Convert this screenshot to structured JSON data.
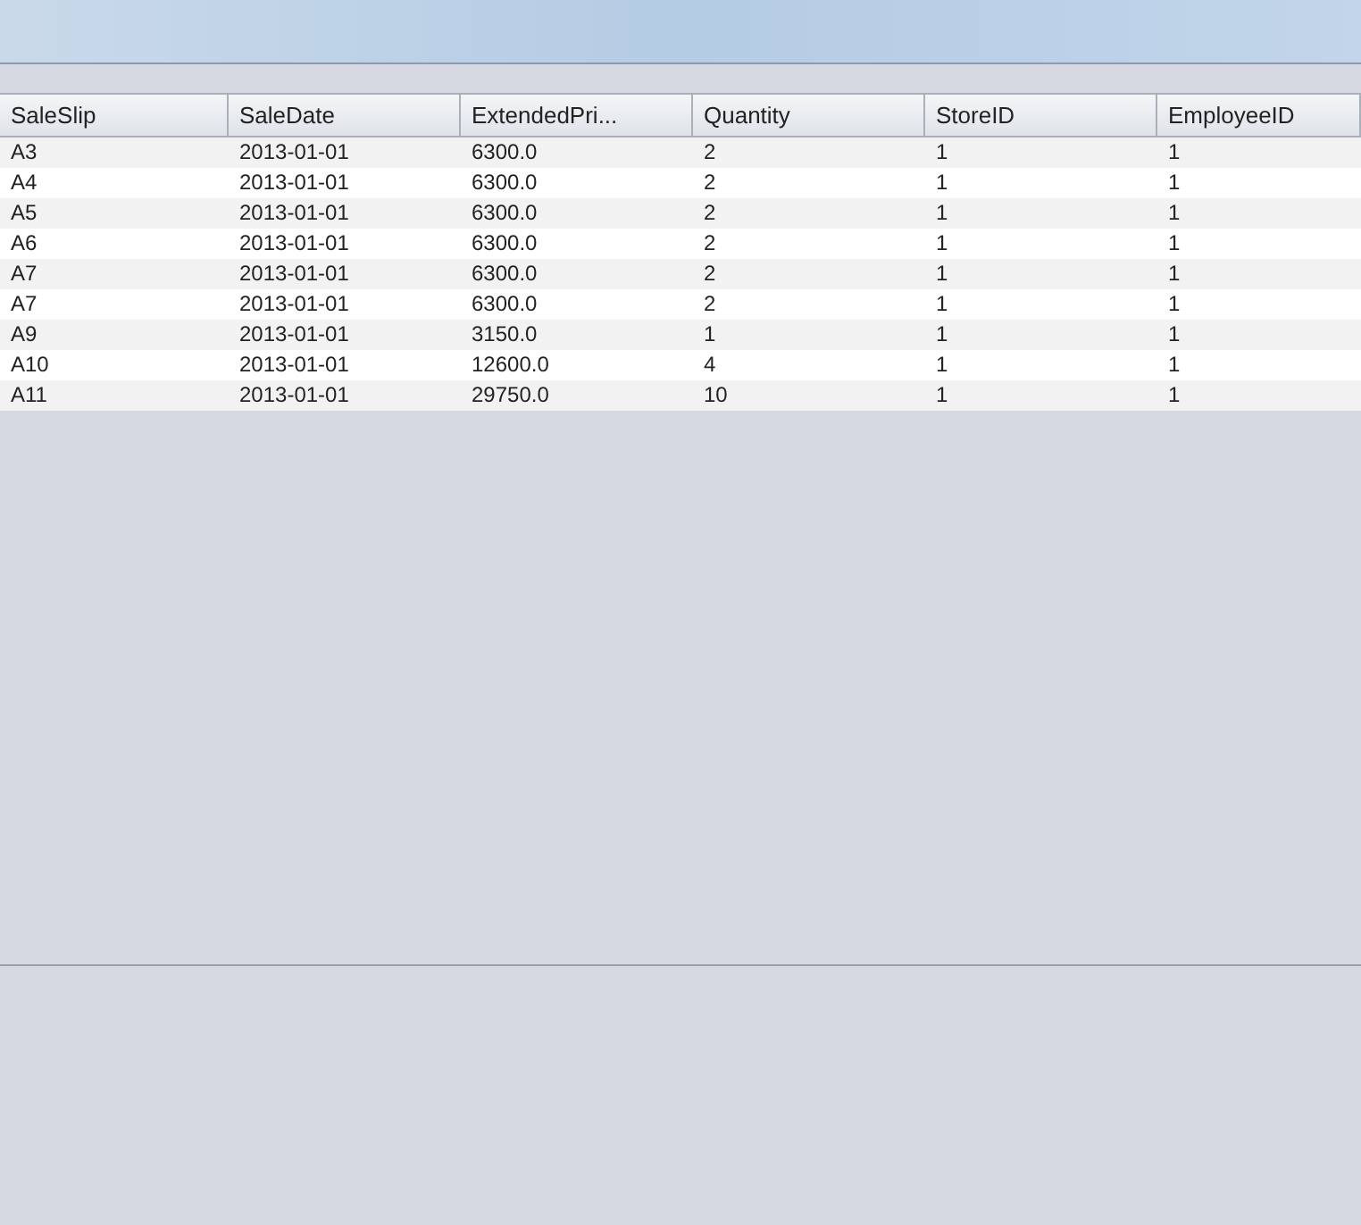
{
  "table": {
    "columns": [
      "SaleSlip",
      "SaleDate",
      "ExtendedPri...",
      "Quantity",
      "StoreID",
      "EmployeeID"
    ],
    "rows": [
      [
        "A3",
        "2013-01-01",
        "6300.0",
        "2",
        "1",
        "1"
      ],
      [
        "A4",
        "2013-01-01",
        "6300.0",
        "2",
        "1",
        "1"
      ],
      [
        "A5",
        "2013-01-01",
        "6300.0",
        "2",
        "1",
        "1"
      ],
      [
        "A6",
        "2013-01-01",
        "6300.0",
        "2",
        "1",
        "1"
      ],
      [
        "A7",
        "2013-01-01",
        "6300.0",
        "2",
        "1",
        "1"
      ],
      [
        "A7",
        "2013-01-01",
        "6300.0",
        "2",
        "1",
        "1"
      ],
      [
        "A9",
        "2013-01-01",
        "3150.0",
        "1",
        "1",
        "1"
      ],
      [
        "A10",
        "2013-01-01",
        "12600.0",
        "4",
        "1",
        "1"
      ],
      [
        "A11",
        "2013-01-01",
        "29750.0",
        "10",
        "1",
        "1"
      ]
    ]
  }
}
